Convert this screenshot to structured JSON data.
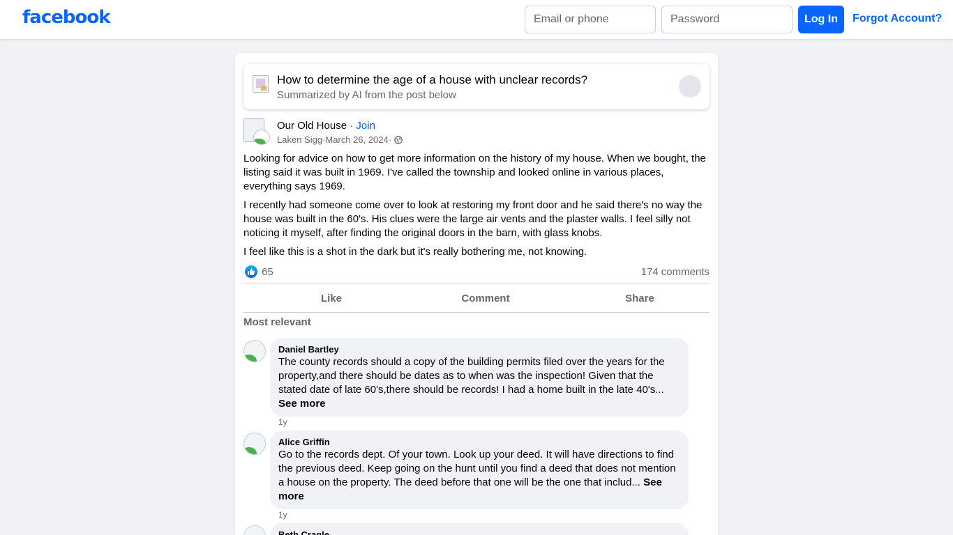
{
  "brand": {
    "logo": "facebook",
    "color": "#0866ff"
  },
  "login": {
    "email_placeholder": "Email or phone",
    "password_placeholder": "Password",
    "login_label": "Log In",
    "forgot_label": "Forgot Account?"
  },
  "ai_summary": {
    "title": "How to determine the age of a house with unclear records?",
    "subtitle": "Summarized by AI from the post below"
  },
  "post": {
    "group": "Our Old House",
    "separator": " · ",
    "join_label": "Join",
    "author": "Laken Sigg",
    "date": "March 26, 2024",
    "privacy_icon": "globe-icon",
    "paragraphs": [
      "Looking for advice on how to get more information on the history of my house. When we bought, the listing said it was built in 1969. I've called the township and looked online in various places, everything says 1969.",
      "I recently had someone come over to look at restoring my front door and he said there's no way the house was built in the 60's. His clues were the large air vents and the plaster walls. I feel silly not noticing it myself, after finding the original doors in the barn, with glass knobs.",
      "I feel like this is a shot in the dark but it's really bothering me, not knowing."
    ],
    "reactions": "65",
    "comments_count": "174 comments",
    "actions": {
      "like": "Like",
      "comment": "Comment",
      "share": "Share"
    }
  },
  "comments_section": {
    "sort_label": "Most relevant",
    "comments": [
      {
        "author": "Daniel Bartley",
        "text": "The county records should a copy of the building permits filed over the years for the property,and there should be dates as to when was the inspection! Given that the stated date of late 60's,there should be records! I had a home built in the late 40's...",
        "see_more": "See more",
        "time": "1y"
      },
      {
        "author": "Alice Griffin",
        "text": "Go to the records dept. Of your town. Look up your deed. It will have directions to find the previous deed. Keep going on the hunt until you find a deed that does not mention a house on the property. The deed before that one will be the one that includ...",
        "see_more": "See more",
        "time": "1y"
      },
      {
        "author": "Beth Cragle"
      }
    ]
  }
}
